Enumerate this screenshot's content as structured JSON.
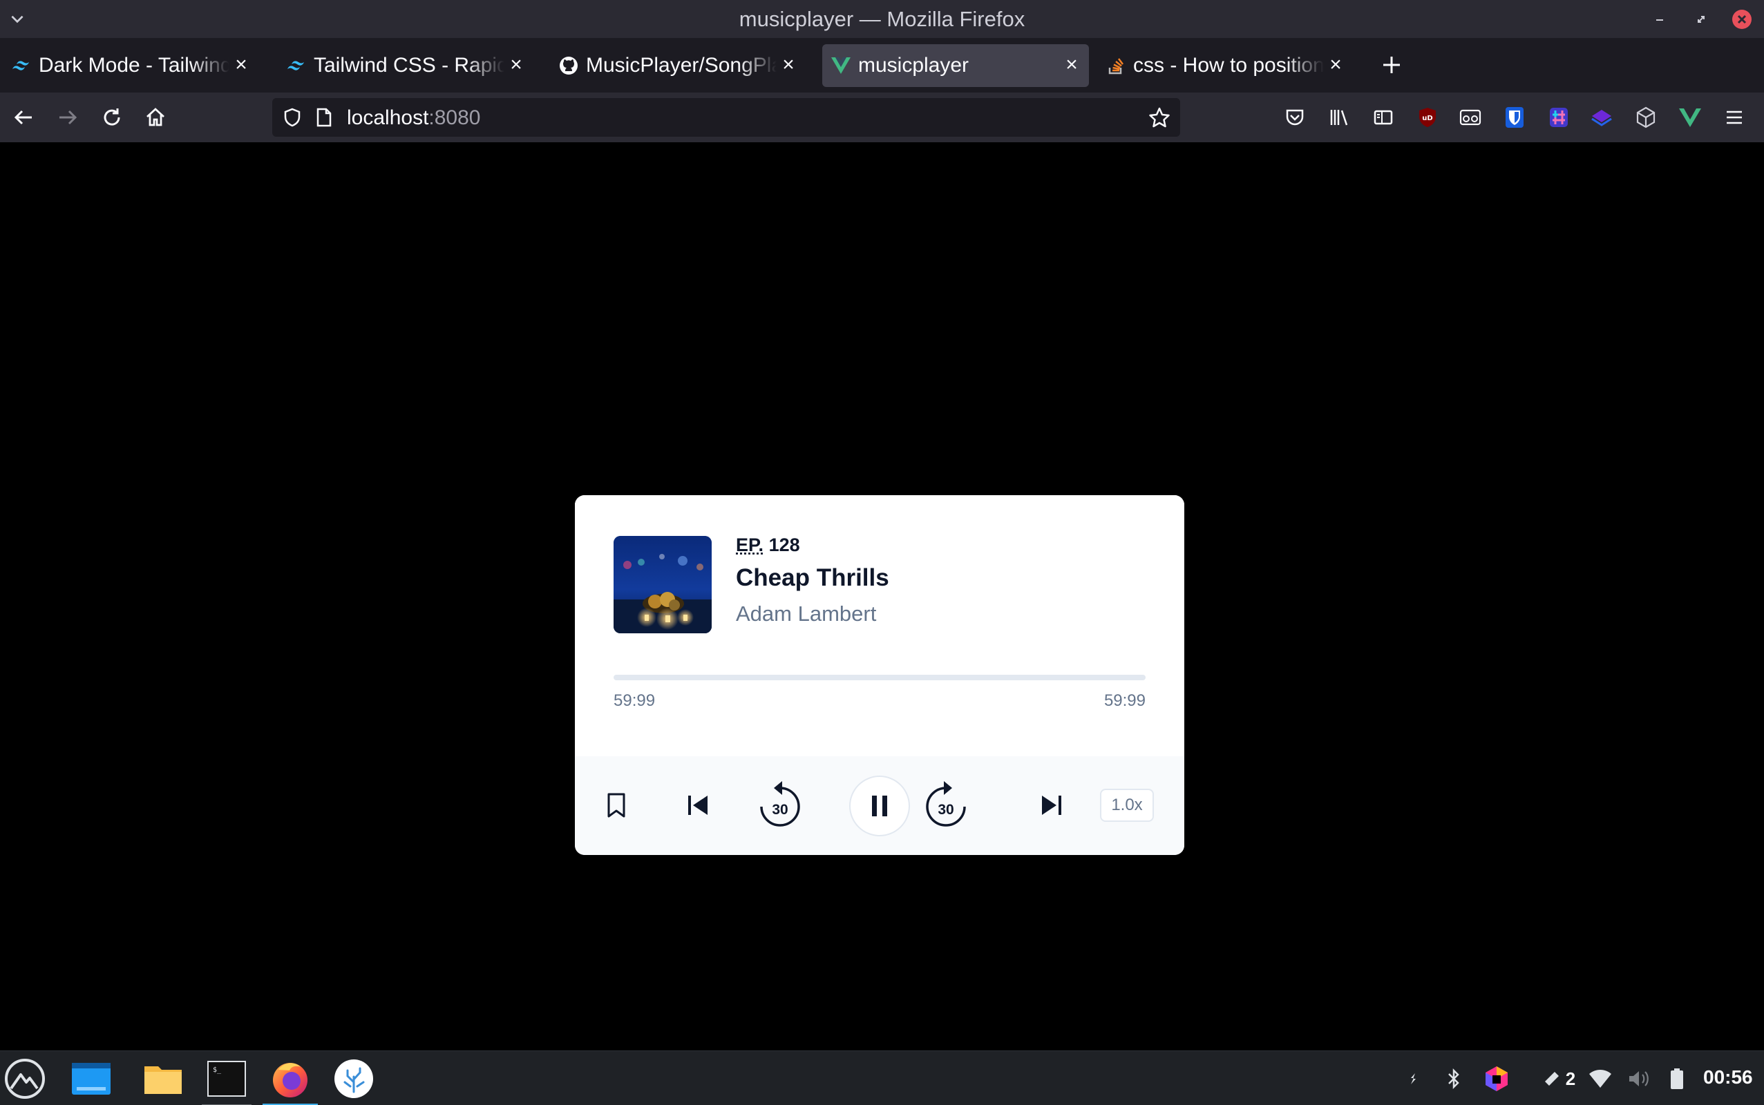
{
  "window": {
    "title": "musicplayer — Mozilla Firefox"
  },
  "tabs": [
    {
      "label": "Dark Mode - Tailwind CSS",
      "favicon": "tailwind-icon",
      "active": false
    },
    {
      "label": "Tailwind CSS - Rapidly build modern websites",
      "favicon": "tailwind-icon",
      "active": false
    },
    {
      "label": "MusicPlayer/SongPlayer",
      "favicon": "github-icon",
      "active": false
    },
    {
      "label": "musicplayer",
      "favicon": "vue-icon",
      "active": true
    },
    {
      "label": "css - How to position a div",
      "favicon": "stackoverflow-icon",
      "active": false
    }
  ],
  "urlbar": {
    "host": "localhost",
    "port": ":8080"
  },
  "player": {
    "episode_prefix": "EP.",
    "episode_number": "128",
    "song_title": "Cheap Thrills",
    "artist": "Adam Lambert",
    "elapsed": "59:99",
    "duration": "59:99",
    "progress": 0,
    "rewind_seconds": "30",
    "forward_seconds": "30",
    "speed": "1.0x"
  },
  "taskbar": {
    "clock": "00:56",
    "notification_count": "2"
  },
  "colors": {
    "titlebar": "#2b2a33",
    "tabstrip": "#1c1b22",
    "active_tab": "#42414d",
    "card": "#ffffff",
    "controls_bg": "#f8fafc",
    "text_primary": "#0f172a",
    "text_secondary": "#64748b"
  }
}
